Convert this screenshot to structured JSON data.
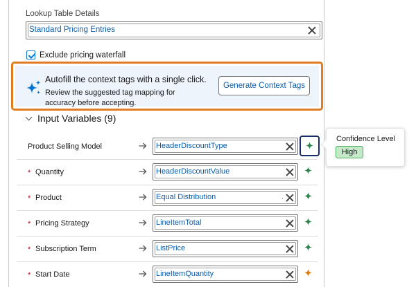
{
  "lookup": {
    "label": "Lookup Table Details",
    "value": "Standard Pricing Entries"
  },
  "exclude": {
    "label": "Exclude pricing waterfall",
    "checked": true
  },
  "autofill": {
    "title": "Autofill the context tags with a single click.",
    "description": "Review the suggested tag mapping for accuracy before accepting.",
    "button_label": "Generate Context Tags"
  },
  "section": {
    "title": "Input Variables (9)"
  },
  "rows": [
    {
      "label": "Product Selling Model",
      "required": false,
      "value": "HeaderDiscountType",
      "confidence": "high"
    },
    {
      "label": "Quantity",
      "required": true,
      "value": "HeaderDiscountValue",
      "confidence": "high"
    },
    {
      "label": "Product",
      "required": true,
      "value": "Equal Distribution",
      "confidence": "high"
    },
    {
      "label": "Pricing Strategy",
      "required": true,
      "value": "LineItemTotal",
      "confidence": "high"
    },
    {
      "label": "Subscription Term",
      "required": true,
      "value": "ListPrice",
      "confidence": "high"
    },
    {
      "label": "Start Date",
      "required": true,
      "value": "LineItemQuantity",
      "confidence": "medium"
    }
  ],
  "required_marker": "*",
  "popover": {
    "title": "Confidence Level",
    "badge": "High"
  },
  "colors": {
    "accent": "#0176d3",
    "link": "#0b5cab",
    "highlight_border": "#e07b1f",
    "star_high": "#2e844a",
    "star_medium": "#dd7a01",
    "badge_bg": "#c5eac9"
  },
  "icons": {
    "autofill": "sparkle-icon",
    "mapping": "arrow-right-icon",
    "clear": "close-icon",
    "confidence": "sparkle-icon",
    "section": "chevron-down-icon"
  }
}
